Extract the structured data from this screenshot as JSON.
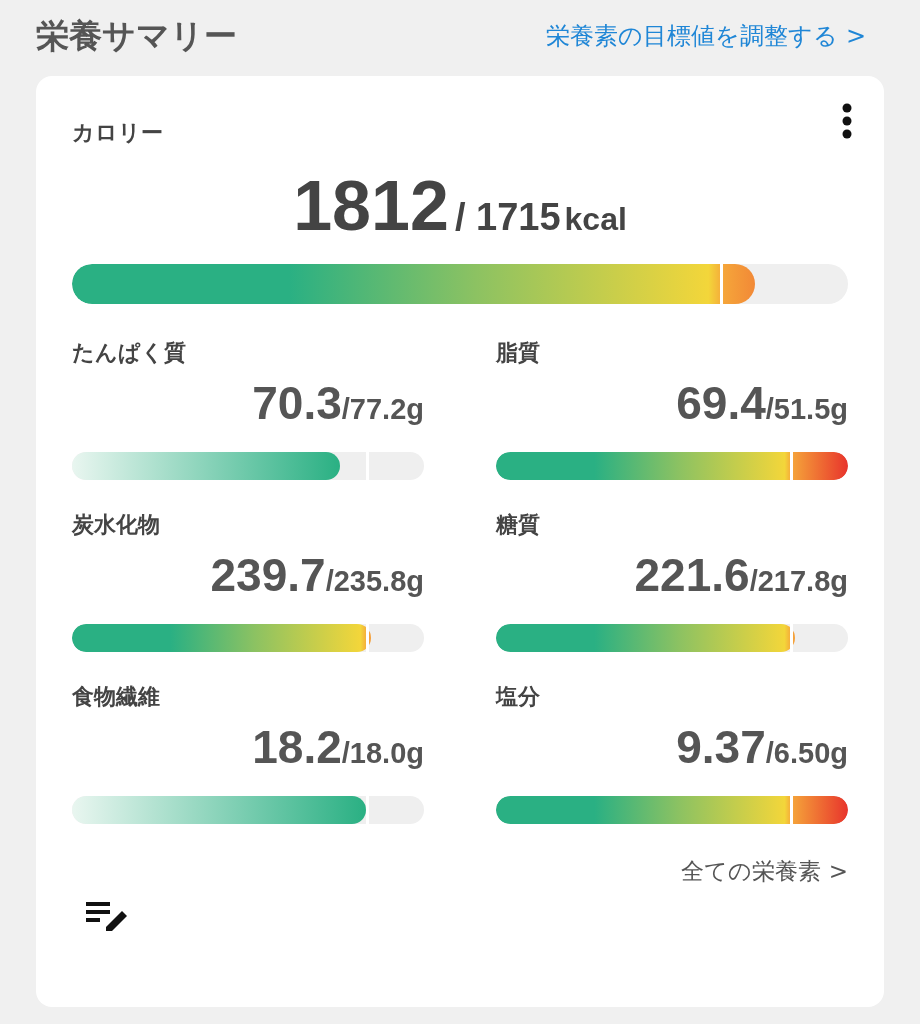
{
  "header": {
    "title": "栄養サマリー",
    "link": "栄養素の目標値を調整する >"
  },
  "calorie": {
    "label": "カロリー",
    "value": "1812",
    "target": "/ 1715",
    "unit": "kcal",
    "kind": "over",
    "level": 0.88
  },
  "nutrients": [
    {
      "label": "たんぱく質",
      "value": "70.3",
      "target": "/77.2g",
      "kind": "under",
      "level": 0.76
    },
    {
      "label": "脂質",
      "value": "69.4",
      "target": "/51.5g",
      "kind": "over",
      "level": 1.0
    },
    {
      "label": "炭水化物",
      "value": "239.7",
      "target": "/235.8g",
      "kind": "over",
      "level": 0.85
    },
    {
      "label": "糖質",
      "value": "221.6",
      "target": "/217.8g",
      "kind": "over",
      "level": 0.85
    },
    {
      "label": "食物繊維",
      "value": "18.2",
      "target": "/18.0g",
      "kind": "under",
      "level": 0.835
    },
    {
      "label": "塩分",
      "value": "9.37",
      "target": "/6.50g",
      "kind": "over",
      "level": 1.0
    }
  ],
  "all_link": "全ての栄養素 >"
}
